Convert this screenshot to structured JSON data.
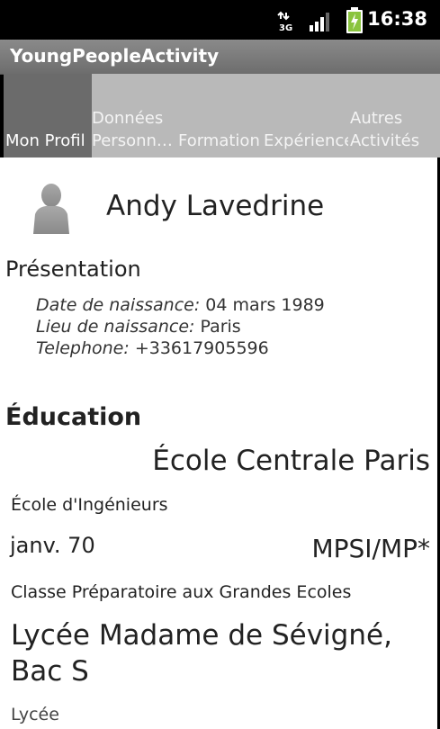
{
  "status_bar": {
    "time": "16:38",
    "network": "3G",
    "icons": [
      "network-3g-icon",
      "signal-icon",
      "battery-charging-icon"
    ]
  },
  "app": {
    "title": "YoungPeopleActivity"
  },
  "tabs": [
    {
      "label": "Mon Profil",
      "active": true
    },
    {
      "label_line1": "Données",
      "label_line2": "Personn…"
    },
    {
      "label": "Formation"
    },
    {
      "label": "Expérience"
    },
    {
      "label_line1": "Autres",
      "label_line2": "Activités"
    }
  ],
  "profile": {
    "name": "Andy Lavedrine",
    "presentation_heading": "Présentation",
    "fields": [
      {
        "label": "Date de naissance:",
        "value": " 04 mars 1989"
      },
      {
        "label": "Lieu de naissance:",
        "value": " Paris"
      },
      {
        "label": "Telephone:",
        "value": " +33617905596"
      }
    ]
  },
  "education": {
    "heading": "Éducation",
    "entries": [
      {
        "school": "École Centrale Paris",
        "type": "École d'Ingénieurs"
      },
      {
        "date": "janv. 70",
        "program": "MPSI/MP*",
        "type": "Classe Préparatoire aux Grandes Ecoles"
      },
      {
        "school_line1": "Lycée Madame de Sévigné,",
        "school_line2": "Bac S",
        "type": "Lycée"
      }
    ]
  }
}
